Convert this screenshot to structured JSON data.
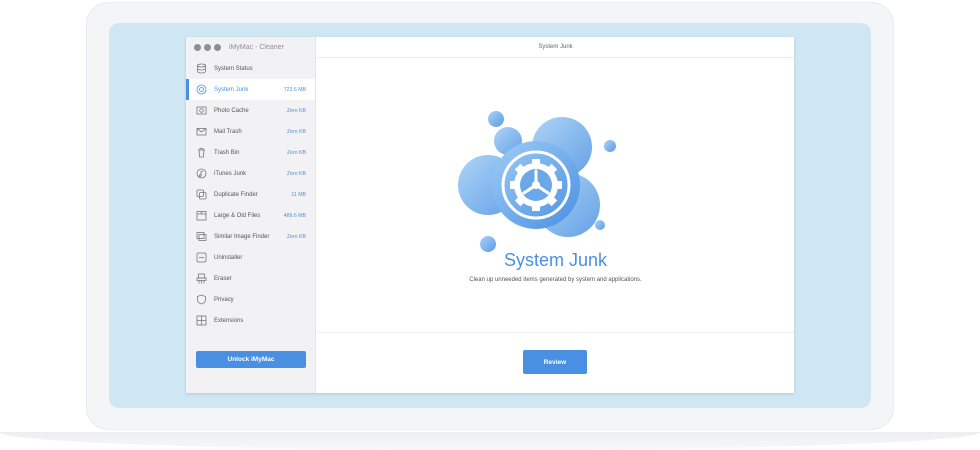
{
  "app": {
    "title": "iMyMac - Cleaner"
  },
  "main": {
    "title": "System Junk",
    "heading": "System Junk",
    "description": "Clean up unneeded items generated by system and applications.",
    "review_label": "Review"
  },
  "sidebar": {
    "unlock_label": "Unlock iMyMac",
    "items": [
      {
        "label": "System Status",
        "size": "",
        "icon": "database-icon"
      },
      {
        "label": "System Junk",
        "size": "723.6 MB",
        "icon": "gear-icon"
      },
      {
        "label": "Photo Cache",
        "size": "Zero KB",
        "icon": "photo-icon"
      },
      {
        "label": "Mail Trash",
        "size": "Zero KB",
        "icon": "mail-icon"
      },
      {
        "label": "Trash Bin",
        "size": "Zero KB",
        "icon": "trash-icon"
      },
      {
        "label": "iTunes Junk",
        "size": "Zero KB",
        "icon": "music-icon"
      },
      {
        "label": "Duplicate Finder",
        "size": "11 MB",
        "icon": "duplicate-icon"
      },
      {
        "label": "Large & Old Files",
        "size": "489.6 MB",
        "icon": "archive-icon"
      },
      {
        "label": "Similar Image Finder",
        "size": "Zero KB",
        "icon": "image-icon"
      },
      {
        "label": "Uninstaller",
        "size": "",
        "icon": "app-icon"
      },
      {
        "label": "Eraser",
        "size": "",
        "icon": "shredder-icon"
      },
      {
        "label": "Privacy",
        "size": "",
        "icon": "shield-icon"
      },
      {
        "label": "Extensions",
        "size": "",
        "icon": "puzzle-icon"
      }
    ]
  },
  "colors": {
    "accent": "#4a90e2",
    "screen": "#cfe6f3",
    "sidebar": "#f2f2f4"
  }
}
